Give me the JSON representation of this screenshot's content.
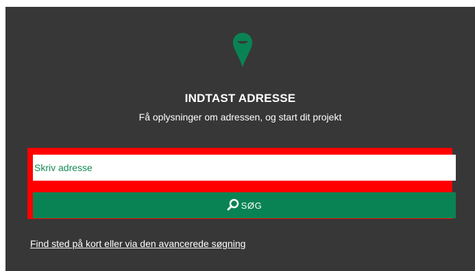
{
  "theme": {
    "panel_color": "#373737",
    "accent": "#0a8354",
    "highlight": "#ff0000",
    "text": "#ffffff"
  },
  "header": {
    "icon": "map-pin-icon",
    "title": "INDTAST ADRESSE",
    "subtitle": "Få oplysninger om adressen, og start dit projekt"
  },
  "search": {
    "placeholder": "Skriv adresse",
    "value": "",
    "button_icon": "search-icon",
    "button_label": "SØG"
  },
  "footer": {
    "link_text": "Find sted på kort eller via den avancerede søgning"
  }
}
